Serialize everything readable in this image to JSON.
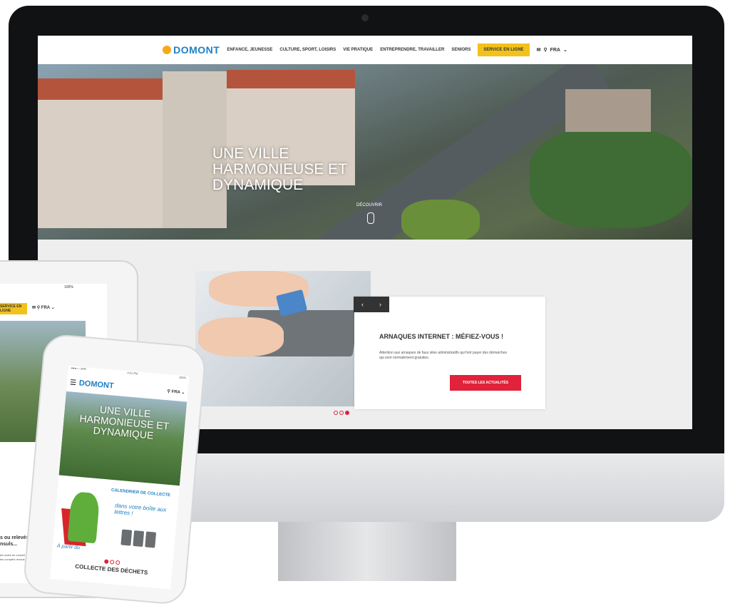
{
  "desktop": {
    "logo": "DOMONT",
    "nav": [
      "ENFANCE, JEUNESSE",
      "CULTURE, SPORT, LOISIRS",
      "VIE PRATIQUE",
      "ENTREPRENDRE, TRAVAILLER",
      "SENIORS"
    ],
    "cta": "SERVICE EN LIGNE",
    "lang": "FRA",
    "hero_title": "UNE VILLE HARMONIEUSE ET DYNAMIQUE",
    "hero_cta": "DÉCOUVRIR",
    "news_title": "ARNAQUES INTERNET : MÉFIEZ-VOUS !",
    "news_text": "Attention aux arnaques de faux sites administratifs qui font payer des démarches qui sont normalement gratuites.",
    "news_button": "TOUTES LES ACTUALITÉS",
    "prev": "‹",
    "next": "›"
  },
  "tablet": {
    "status": "100%",
    "cta": "SERVICE EN LIGNE",
    "lang": "FRA",
    "text": "s ou relevés de nsuls...",
    "small": "les actes du conseil municipal et les comptes rendus"
  },
  "phone": {
    "status_left": "●●●○○ SFR",
    "status_time": "4:21 PM",
    "status_right": "100%",
    "logo": "DOMONT",
    "lang": "FRA",
    "hero_title": "UNE VILLE HARMONIEUSE ET DYNAMIQUE",
    "promo_title": "CALENDRIER DE COLLECTE",
    "promo_script": "dans votre boîte aux lettres !",
    "from": "À partir du",
    "footer": "COLLECTE DES DÉCHETS"
  }
}
